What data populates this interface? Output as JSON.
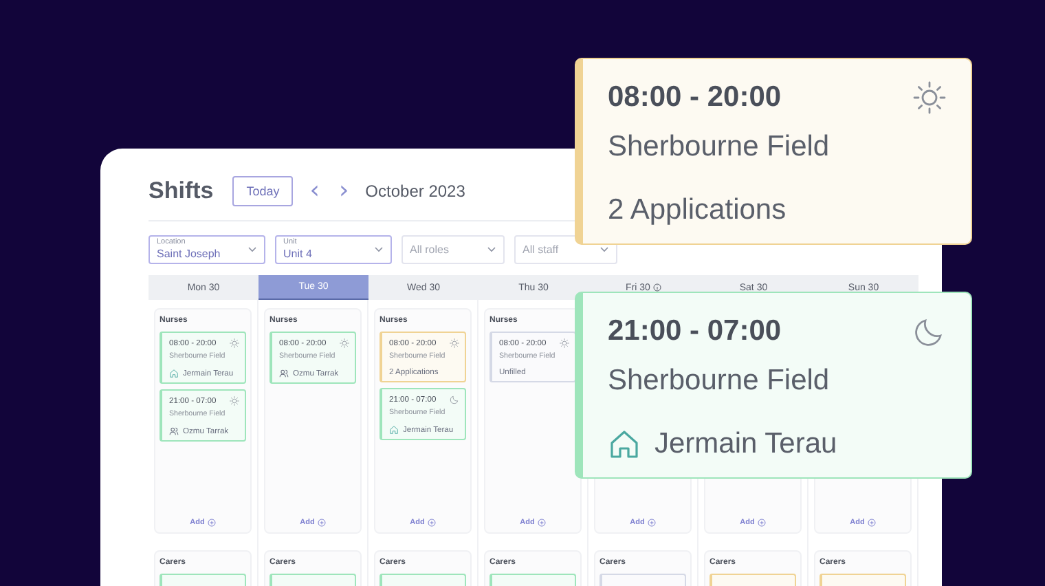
{
  "header": {
    "title": "Shifts",
    "today_button": "Today",
    "prev": "‹",
    "next": "›",
    "month": "October 2023"
  },
  "filters": [
    {
      "label": "Location",
      "value": "Saint Joseph"
    },
    {
      "label": "Unit",
      "value": "Unit 4"
    },
    {
      "placeholder": "All roles"
    },
    {
      "placeholder": "All staff"
    }
  ],
  "days": [
    {
      "label": "Mon 30",
      "selected": false,
      "info": false,
      "nurses": {
        "title": "Nurses",
        "add": "Add",
        "shifts": [
          {
            "time": "08:00 - 20:00",
            "place": "Sherbourne Field",
            "color": "#9ee5bb",
            "night": false,
            "kind": "home",
            "assignee": "Jermain Terau"
          },
          {
            "time": "21:00 - 07:00",
            "place": "Sherbourne Field",
            "color": "#9ee5bb",
            "night": false,
            "kind": "people",
            "assignee": "Ozmu Tarrak"
          }
        ]
      },
      "carers": {
        "title": "Carers",
        "shifts": [
          {
            "color": "#9ee5bb"
          }
        ]
      }
    },
    {
      "label": "Tue 30",
      "selected": true,
      "info": false,
      "nurses": {
        "title": "Nurses",
        "add": "Add",
        "shifts": [
          {
            "time": "08:00 - 20:00",
            "place": "Sherbourne Field",
            "color": "#9ee5bb",
            "night": false,
            "kind": "people",
            "assignee": "Ozmu Tarrak"
          }
        ]
      },
      "carers": {
        "title": "Carers",
        "shifts": [
          {
            "color": "#9ee5bb"
          }
        ]
      }
    },
    {
      "label": "Wed 30",
      "selected": false,
      "info": false,
      "nurses": {
        "title": "Nurses",
        "add": "Add",
        "shifts": [
          {
            "time": "08:00 - 20:00",
            "place": "Sherbourne Field",
            "color": "#f0d394",
            "night": false,
            "kind": "plain",
            "assignee": "2 Applications"
          },
          {
            "time": "21:00 - 07:00",
            "place": "Sherbourne Field",
            "color": "#9ee5bb",
            "night": true,
            "kind": "home",
            "assignee": "Jermain Terau"
          }
        ]
      },
      "carers": {
        "title": "Carers",
        "shifts": [
          {
            "color": "#9ee5bb"
          }
        ]
      }
    },
    {
      "label": "Thu 30",
      "selected": false,
      "info": false,
      "nurses": {
        "title": "Nurses",
        "add": "Add",
        "shifts": [
          {
            "time": "08:00 - 20:00",
            "place": "Sherbourne Field",
            "color": "#d5d9e6",
            "night": false,
            "kind": "plain",
            "assignee": "Unfilled"
          }
        ]
      },
      "carers": {
        "title": "Carers",
        "shifts": [
          {
            "color": "#9ee5bb"
          }
        ]
      }
    },
    {
      "label": "Fri 30",
      "selected": false,
      "info": true,
      "nurses": {
        "add": "Add"
      },
      "carers": {
        "title": "Carers",
        "shifts": [
          {
            "color": "#d5d9e6"
          }
        ]
      }
    },
    {
      "label": "Sat 30",
      "selected": false,
      "info": false,
      "nurses": {
        "add": "Add"
      },
      "carers": {
        "title": "Carers",
        "shifts": [
          {
            "color": "#f0d394"
          }
        ]
      }
    },
    {
      "label": "Sun 30",
      "selected": false,
      "info": false,
      "nurses": {
        "add": "Add"
      },
      "carers": {
        "title": "Carers",
        "shifts": [
          {
            "color": "#f0d394"
          }
        ]
      }
    }
  ],
  "zoomed_cards": [
    {
      "time": "08:00 - 20:00",
      "place": "Sherbourne Field",
      "color": "#f0d394",
      "night": false,
      "kind": "plain",
      "assignee": "2 Applications"
    },
    {
      "time": "21:00 - 07:00",
      "place": "Sherbourne Field",
      "color": "#9ee5bb",
      "night": true,
      "kind": "home",
      "assignee": "Jermain Terau"
    }
  ]
}
